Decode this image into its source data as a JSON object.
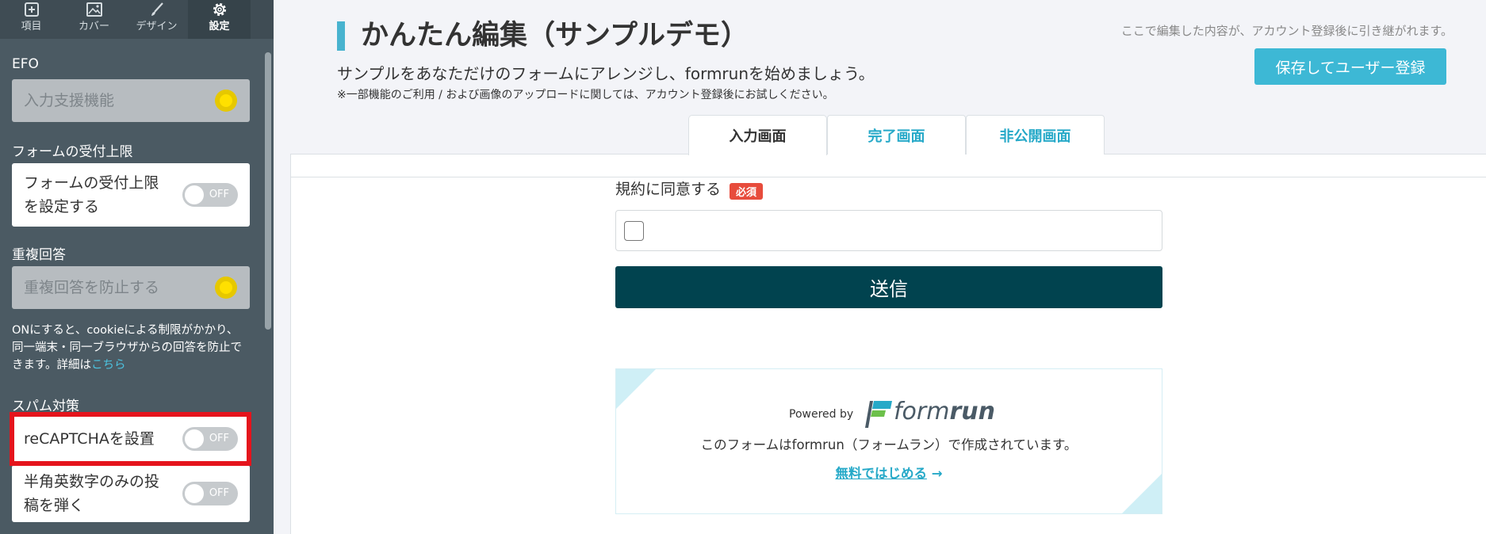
{
  "sidebar": {
    "tabs": [
      {
        "label": "項目",
        "icon": "plus-square-icon"
      },
      {
        "label": "カバー",
        "icon": "image-icon"
      },
      {
        "label": "デザイン",
        "icon": "brush-icon"
      },
      {
        "label": "設定",
        "icon": "gear-icon"
      }
    ],
    "active_tab": "設定",
    "efo": {
      "title": "EFO",
      "label": "入力支援機能"
    },
    "limit": {
      "title": "フォームの受付上限",
      "label_line1": "フォームの受付上限",
      "label_line2": "を設定する",
      "toggle": "OFF"
    },
    "duplicate": {
      "title": "重複回答",
      "label": "重複回答を防止する",
      "note_line1": "ONにすると、cookieによる制限がかかり、",
      "note_line2": "同一端末・同一ブラウザからの回答を防止で",
      "note_line3_prefix": "きます。詳細は",
      "note_link": "こちら"
    },
    "spam": {
      "title": "スパム対策",
      "recaptcha_label": "reCAPTCHAを設置",
      "recaptcha_toggle": "OFF",
      "alnum_label_line1": "半角英数字のみの投",
      "alnum_label_line2": "稿を弾く",
      "alnum_toggle": "OFF"
    }
  },
  "header": {
    "title": "かんたん編集（サンプルデモ）",
    "subtitle": "サンプルをあなただけのフォームにアレンジし、formrunを始めましょう。",
    "note": "※一部機能のご利用 / および画像のアップロードに関しては、アカウント登録後にお試しください。",
    "right_note": "ここで編集した内容が、アカウント登録後に引き継がれます。",
    "save_button": "保存してユーザー登録"
  },
  "form_tabs": [
    "入力画面",
    "完了画面",
    "非公開画面"
  ],
  "form": {
    "agree_label": "規約に同意する",
    "required_badge": "必須",
    "submit_label": "送信"
  },
  "powered": {
    "powered_by": "Powered by",
    "logo_text_light": "form",
    "logo_text_bold": "run",
    "made_with": "このフォームはformrun（フォームラン）で作成されています。",
    "start_link": "無料ではじめる",
    "arrow": "→"
  },
  "colors": {
    "sidebar_bg": "#4b5a63",
    "accent": "#3db8d5",
    "submit": "#01434f",
    "required": "#e74c3c",
    "highlight": "#e5141c"
  }
}
